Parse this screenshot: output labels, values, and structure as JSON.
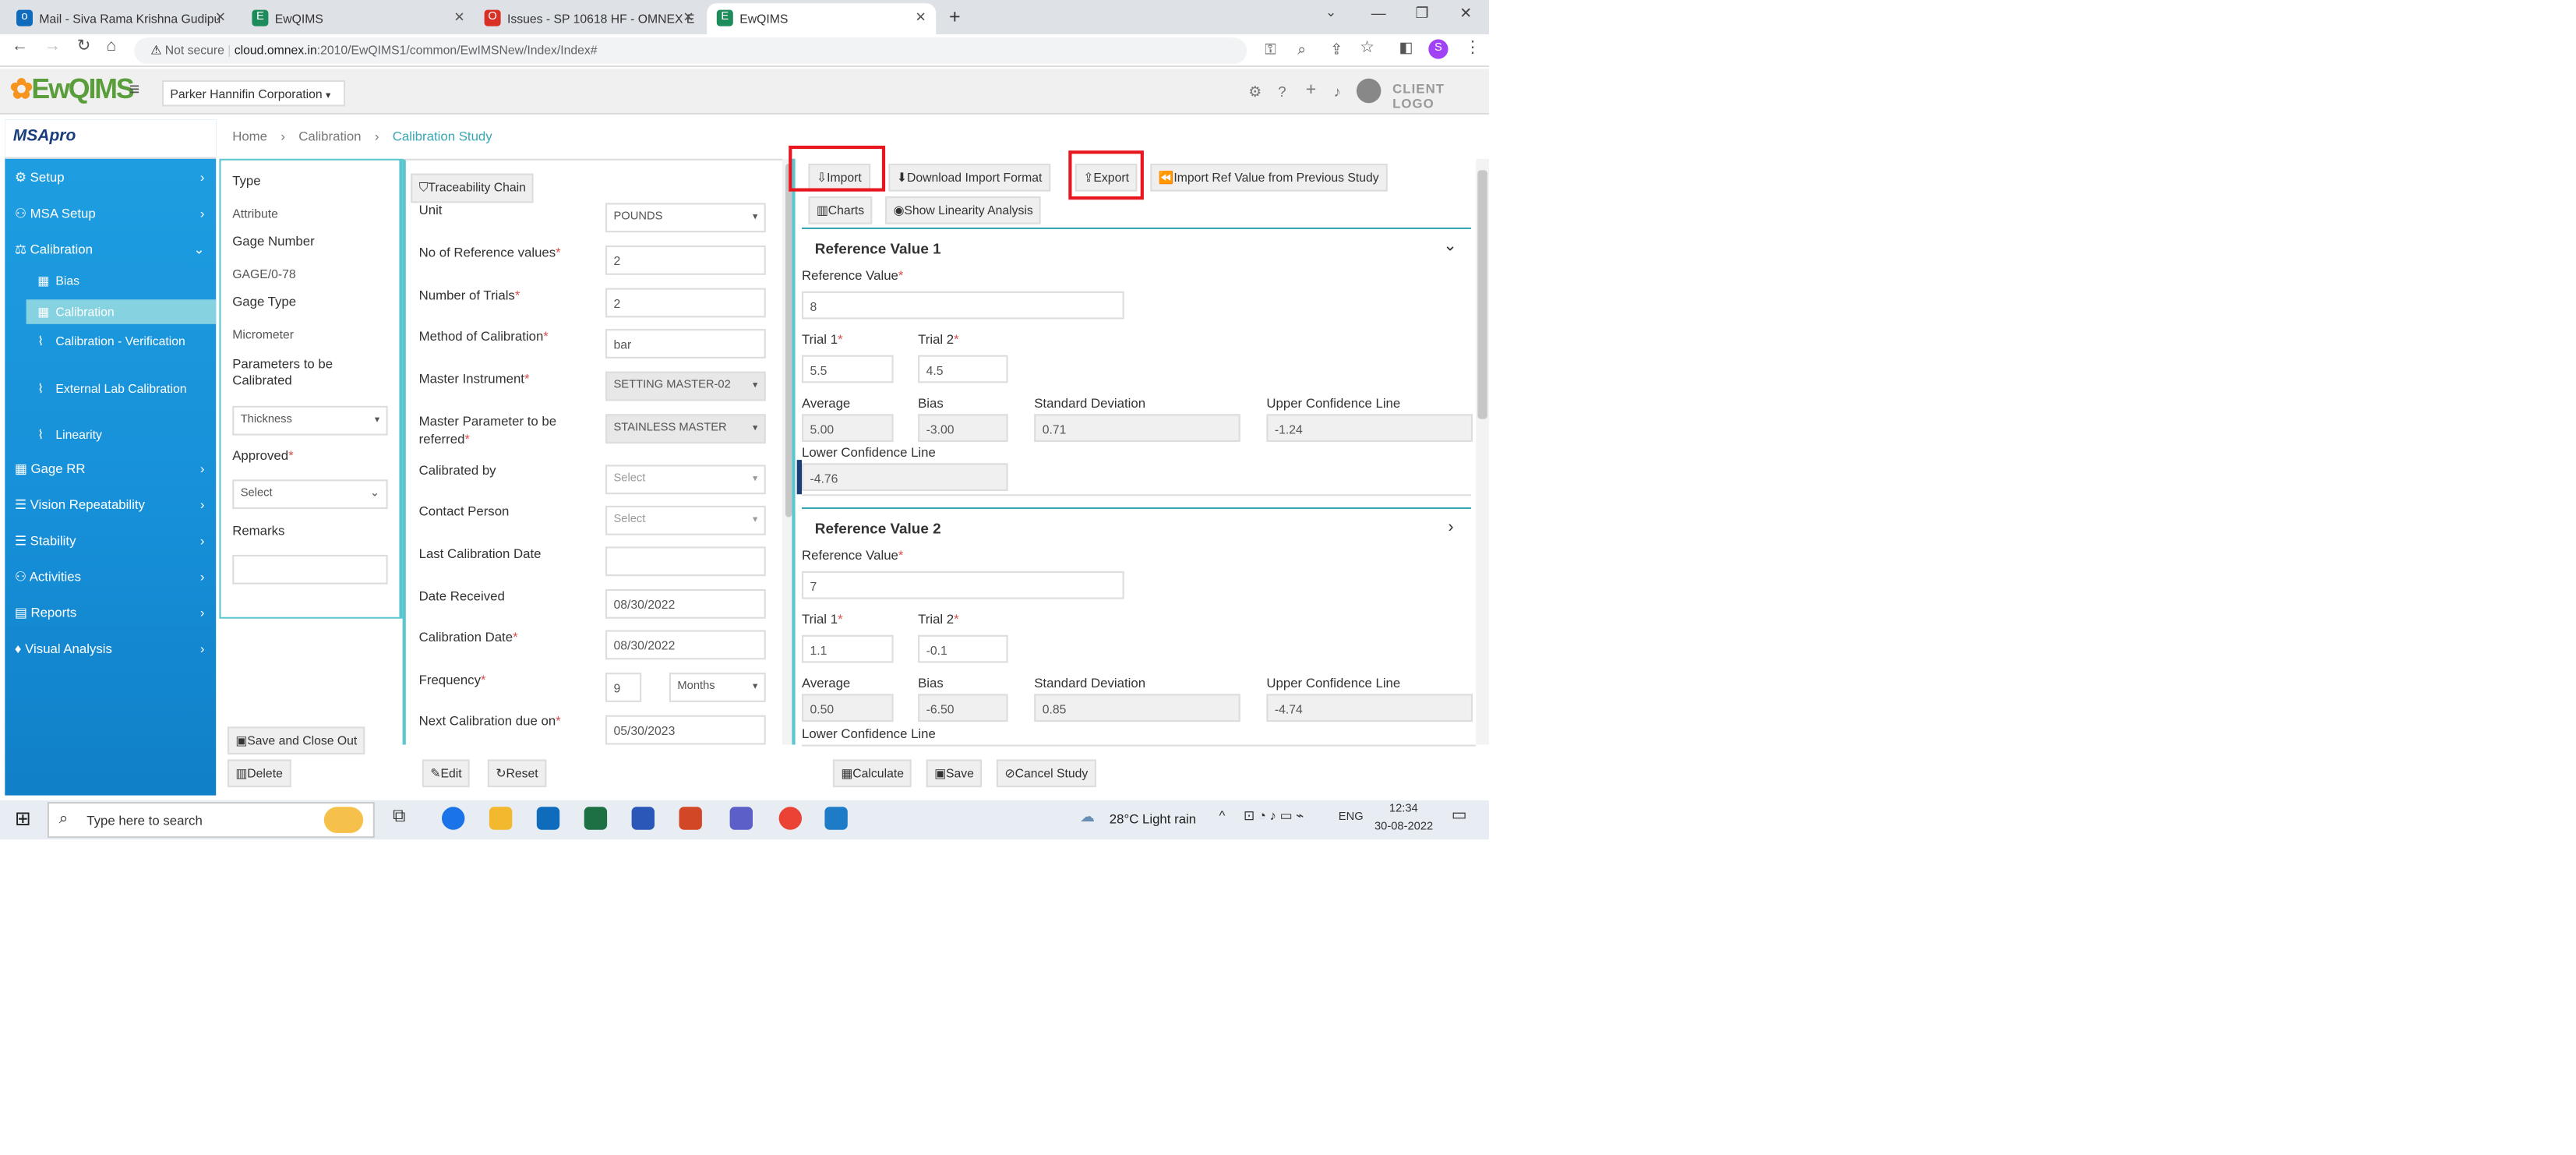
{
  "browser": {
    "tabs": [
      {
        "title": "Mail - Siva Rama Krishna Gudipu",
        "icon_color": "#0f6cbd"
      },
      {
        "title": "EwQIMS",
        "icon_color": "#1e8c5a"
      },
      {
        "title": "Issues - SP 10618 HF - OMNEX E",
        "icon_color": "#d93025"
      },
      {
        "title": "EwQIMS",
        "icon_color": "#1e8c5a"
      }
    ],
    "new_tab": "+",
    "not_secure": "Not secure",
    "url_host": "cloud.omnex.in",
    "url_path": ":2010/EwQIMS1/common/EwIMSNew/Index/Index#",
    "profile_initial": "S"
  },
  "app": {
    "logo_text": "EwQIMS",
    "company": "Parker Hannifin Corporation",
    "client_logo": "CLIENT LOGO",
    "module_brand": "MSApro"
  },
  "sidebar": {
    "items": [
      {
        "label": "Setup"
      },
      {
        "label": "MSA Setup"
      },
      {
        "label": "Calibration"
      },
      {
        "label": "Gage RR"
      },
      {
        "label": "Vision Repeatability"
      },
      {
        "label": "Stability"
      },
      {
        "label": "Activities"
      },
      {
        "label": "Reports"
      },
      {
        "label": "Visual Analysis"
      }
    ],
    "subitems": [
      {
        "label": "Bias"
      },
      {
        "label": "Calibration"
      },
      {
        "label": "Calibration - Verification"
      },
      {
        "label": "External Lab Calibration"
      },
      {
        "label": "Linearity"
      }
    ]
  },
  "breadcrumb": {
    "home": "Home",
    "section": "Calibration",
    "current": "Calibration Study"
  },
  "left_panel": {
    "type_label": "Type",
    "type_value": "Attribute",
    "gage_number_label": "Gage Number",
    "gage_number_value": "GAGE/0-78",
    "gage_type_label": "Gage Type",
    "gage_type_value": "Micrometer",
    "params_label": "Parameters to be Calibrated",
    "params_value": "Thickness",
    "approved_label": "Approved",
    "approved_value": "Select",
    "remarks_label": "Remarks",
    "remarks_value": "",
    "save_close": "Save and Close Out",
    "delete": "Delete"
  },
  "middle_panel": {
    "traceability": "Traceability Chain",
    "unit_label": "Unit",
    "unit_value": "POUNDS",
    "num_ref_label": "No of Reference values",
    "num_ref_value": "2",
    "num_trials_label": "Number of Trials",
    "num_trials_value": "2",
    "method_label": "Method of Calibration",
    "method_value": "bar",
    "master_inst_label": "Master Instrument",
    "master_inst_value": "SETTING MASTER-02",
    "master_param_label": "Master Parameter to be referred",
    "master_param_value": "STAINLESS MASTER",
    "calibrated_by_label": "Calibrated by",
    "calibrated_by_value": "Select",
    "contact_label": "Contact Person",
    "contact_value": "Select",
    "last_cal_label": "Last Calibration Date",
    "last_cal_value": "",
    "date_received_label": "Date Received",
    "date_received_value": "08/30/2022",
    "cal_date_label": "Calibration Date",
    "cal_date_value": "08/30/2022",
    "frequency_label": "Frequency",
    "frequency_value": "9",
    "frequency_unit": "Months",
    "next_cal_label": "Next Calibration due on",
    "next_cal_value": "05/30/2023",
    "edit": "Edit",
    "reset": "Reset"
  },
  "right_panel": {
    "import": "Import",
    "download_format": "Download Import Format",
    "export": "Export",
    "import_ref": "Import Ref Value from Previous Study",
    "charts": "Charts",
    "linearity": "Show Linearity Analysis",
    "ref_label": "Reference Value",
    "trial1_label": "Trial 1",
    "trial2_label": "Trial 2",
    "avg_label": "Average",
    "bias_label": "Bias",
    "sd_label": "Standard Deviation",
    "ucl_label": "Upper Confidence Line",
    "lcl_label": "Lower Confidence Line",
    "cards": [
      {
        "title": "Reference Value 1",
        "ref": "8",
        "trial1": "5.5",
        "trial2": "4.5",
        "avg": "5.00",
        "bias": "-3.00",
        "sd": "0.71",
        "ucl": "-1.24",
        "lcl": "-4.76"
      },
      {
        "title": "Reference Value 2",
        "ref": "7",
        "trial1": "1.1",
        "trial2": "-0.1",
        "avg": "0.50",
        "bias": "-6.50",
        "sd": "0.85",
        "ucl": "-4.74",
        "lcl": ""
      }
    ],
    "calculate": "Calculate",
    "save": "Save",
    "cancel": "Cancel Study"
  },
  "taskbar": {
    "search_placeholder": "Type here to search",
    "weather": "28°C  Light rain",
    "lang": "ENG",
    "time": "12:34",
    "date": "30-08-2022"
  }
}
